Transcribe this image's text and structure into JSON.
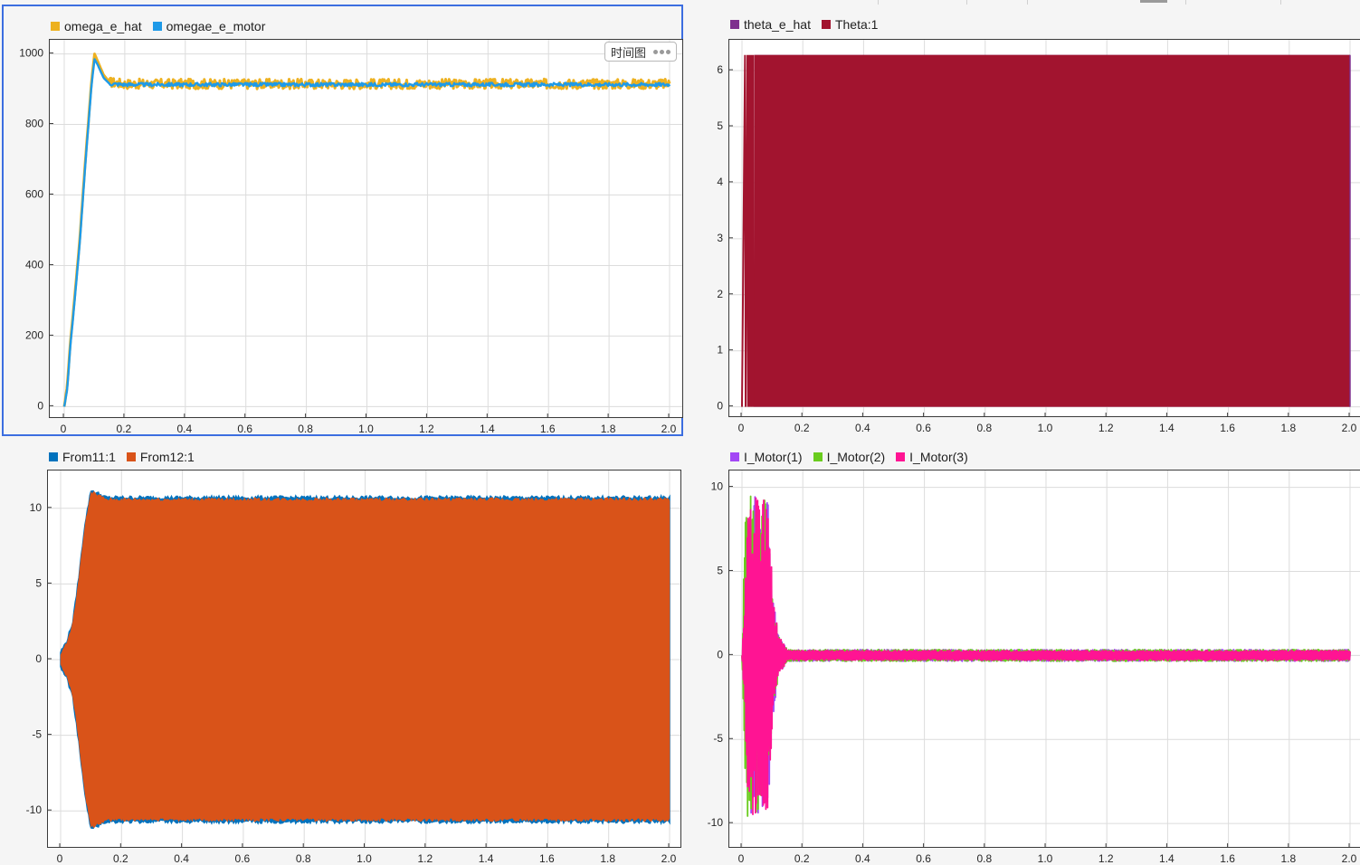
{
  "panels": [
    {
      "id": "p1",
      "selected": true,
      "badge": "时间图",
      "chart_data": {
        "type": "line",
        "legend": [
          {
            "name": "omega_e_hat",
            "color": "#EDB120"
          },
          {
            "name": "omegae_e_motor",
            "color": "#1E9AE8"
          }
        ],
        "xlim": [
          0,
          2.0
        ],
        "ylim": [
          -35,
          1040
        ],
        "xticks": [
          0,
          0.2,
          0.4,
          0.6,
          0.8,
          1.0,
          1.2,
          1.4,
          1.6,
          1.8,
          2.0
        ],
        "xtick_labels": [
          "0",
          "0.2",
          "0.4",
          "0.6",
          "0.8",
          "1.0",
          "1.2",
          "1.4",
          "1.6",
          "1.8",
          "2.0"
        ],
        "yticks": [
          0,
          200,
          400,
          600,
          800,
          1000
        ],
        "ytick_labels": [
          "0",
          "200",
          "400",
          "600",
          "800",
          "1000"
        ],
        "grid": true,
        "series": [
          {
            "name": "omega_e_hat",
            "color": "#EDB120",
            "x": [
              0,
              0.01,
              0.02,
              0.03,
              0.05,
              0.07,
              0.09,
              0.1,
              0.11,
              0.13,
              0.15,
              0.2,
              2.0
            ],
            "y": [
              0,
              60,
              180,
              270,
              460,
              700,
              920,
              1000,
              980,
              940,
              920,
              915,
              915
            ],
            "band": 14
          },
          {
            "name": "omegae_e_motor",
            "color": "#1E9AE8",
            "x": [
              0,
              0.01,
              0.02,
              0.03,
              0.05,
              0.07,
              0.09,
              0.1,
              0.11,
              0.13,
              0.15,
              0.2,
              2.0
            ],
            "y": [
              0,
              50,
              170,
              260,
              450,
              690,
              910,
              985,
              970,
              932,
              915,
              913,
              913
            ],
            "band": 5
          }
        ]
      }
    },
    {
      "id": "p2",
      "selected": false,
      "chart_data": {
        "type": "line",
        "legend": [
          {
            "name": "theta_e_hat",
            "color": "#7E2F8E"
          },
          {
            "name": "Theta:1",
            "color": "#A2142F"
          }
        ],
        "xlim": [
          0,
          2.0
        ],
        "ylim": [
          -0.2,
          6.55
        ],
        "xticks": [
          0,
          0.2,
          0.4,
          0.6,
          0.8,
          1.0,
          1.2,
          1.4,
          1.6,
          1.8,
          2.0
        ],
        "xtick_labels": [
          "0",
          "0.2",
          "0.4",
          "0.6",
          "0.8",
          "1.0",
          "1.2",
          "1.4",
          "1.6",
          "1.8",
          "2.0"
        ],
        "yticks": [
          0,
          1,
          2,
          3,
          4,
          5,
          6
        ],
        "ytick_labels": [
          "0",
          "1",
          "2",
          "3",
          "4",
          "5",
          "6"
        ],
        "grid": true,
        "series": [
          {
            "name": "theta_e_hat",
            "color": "#7E2F8E",
            "band_min": 0,
            "band_max": 6.28,
            "start": 0.04,
            "end": 2.0
          },
          {
            "name": "Theta:1",
            "color": "#A2142F",
            "band_min": 0,
            "band_max": 6.28,
            "start": 0.04,
            "end": 2.0
          }
        ]
      }
    },
    {
      "id": "p3",
      "selected": false,
      "chart_data": {
        "type": "line",
        "legend": [
          {
            "name": "From11:1",
            "color": "#0072BD"
          },
          {
            "name": "From12:1",
            "color": "#D95319"
          }
        ],
        "xlim": [
          0,
          2.0
        ],
        "ylim": [
          -12.5,
          12.5
        ],
        "xticks": [
          0,
          0.2,
          0.4,
          0.6,
          0.8,
          1.0,
          1.2,
          1.4,
          1.6,
          1.8,
          2.0
        ],
        "xtick_labels": [
          "0",
          "0.2",
          "0.4",
          "0.6",
          "0.8",
          "1.0",
          "1.2",
          "1.4",
          "1.6",
          "1.8",
          "2.0"
        ],
        "yticks": [
          -10,
          -5,
          0,
          5,
          10
        ],
        "ytick_labels": [
          "-10",
          "-5",
          "0",
          "5",
          "10"
        ],
        "grid": true,
        "series": [
          {
            "name": "From11:1",
            "color": "#0072BD",
            "envelope_x": [
              0,
              0.02,
              0.04,
              0.06,
              0.08,
              0.1,
              0.12,
              0.15,
              2.0
            ],
            "envelope_y": [
              0.5,
              1.2,
              2.5,
              5.5,
              9,
              11.2,
              11.0,
              10.7,
              10.7
            ]
          },
          {
            "name": "From12:1",
            "color": "#D95319",
            "envelope_x": [
              0,
              0.02,
              0.04,
              0.06,
              0.08,
              0.1,
              0.12,
              0.15,
              2.0
            ],
            "envelope_y": [
              0.4,
              1.1,
              2.4,
              5.4,
              8.9,
              11.1,
              10.9,
              10.6,
              10.6
            ]
          }
        ]
      }
    },
    {
      "id": "p4",
      "selected": false,
      "chart_data": {
        "type": "line",
        "legend": [
          {
            "name": "I_Motor(1)",
            "color": "#A347F5"
          },
          {
            "name": "I_Motor(2)",
            "color": "#6ACC1E"
          },
          {
            "name": "I_Motor(3)",
            "color": "#FF1493"
          }
        ],
        "xlim": [
          0,
          2.0
        ],
        "ylim": [
          -11.5,
          11.0
        ],
        "xticks": [
          0,
          0.2,
          0.4,
          0.6,
          0.8,
          1.0,
          1.2,
          1.4,
          1.6,
          1.8,
          2.0
        ],
        "xtick_labels": [
          "0",
          "0.2",
          "0.4",
          "0.6",
          "0.8",
          "1.0",
          "1.2",
          "1.4",
          "1.6",
          "1.8",
          "2.0"
        ],
        "yticks": [
          -10,
          -5,
          0,
          5,
          10
        ],
        "ytick_labels": [
          "-10",
          "-5",
          "0",
          "5",
          "10"
        ],
        "grid": true,
        "series": [
          {
            "name": "I_Motor(1)",
            "color": "#A347F5",
            "envelope_x": [
              0,
              0.01,
              0.02,
              0.03,
              0.06,
              0.09,
              0.1,
              0.12,
              0.15,
              2.0
            ],
            "envelope_y": [
              0,
              5,
              9.5,
              10,
              9.3,
              9.2,
              4,
              1.2,
              0.35,
              0.35
            ]
          },
          {
            "name": "I_Motor(2)",
            "color": "#6ACC1E",
            "envelope_x": [
              0,
              0.01,
              0.02,
              0.03,
              0.06,
              0.09,
              0.1,
              0.12,
              0.15,
              2.0
            ],
            "envelope_y": [
              0,
              8,
              10,
              9.8,
              9.3,
              9.2,
              4,
              1.2,
              0.35,
              0.35
            ]
          },
          {
            "name": "I_Motor(3)",
            "color": "#FF1493",
            "envelope_x": [
              0,
              0.01,
              0.02,
              0.03,
              0.06,
              0.09,
              0.1,
              0.12,
              0.15,
              2.0
            ],
            "envelope_y": [
              0,
              4,
              8.5,
              9.5,
              9.3,
              9.2,
              4,
              1.2,
              0.3,
              0.3
            ]
          }
        ]
      }
    }
  ]
}
